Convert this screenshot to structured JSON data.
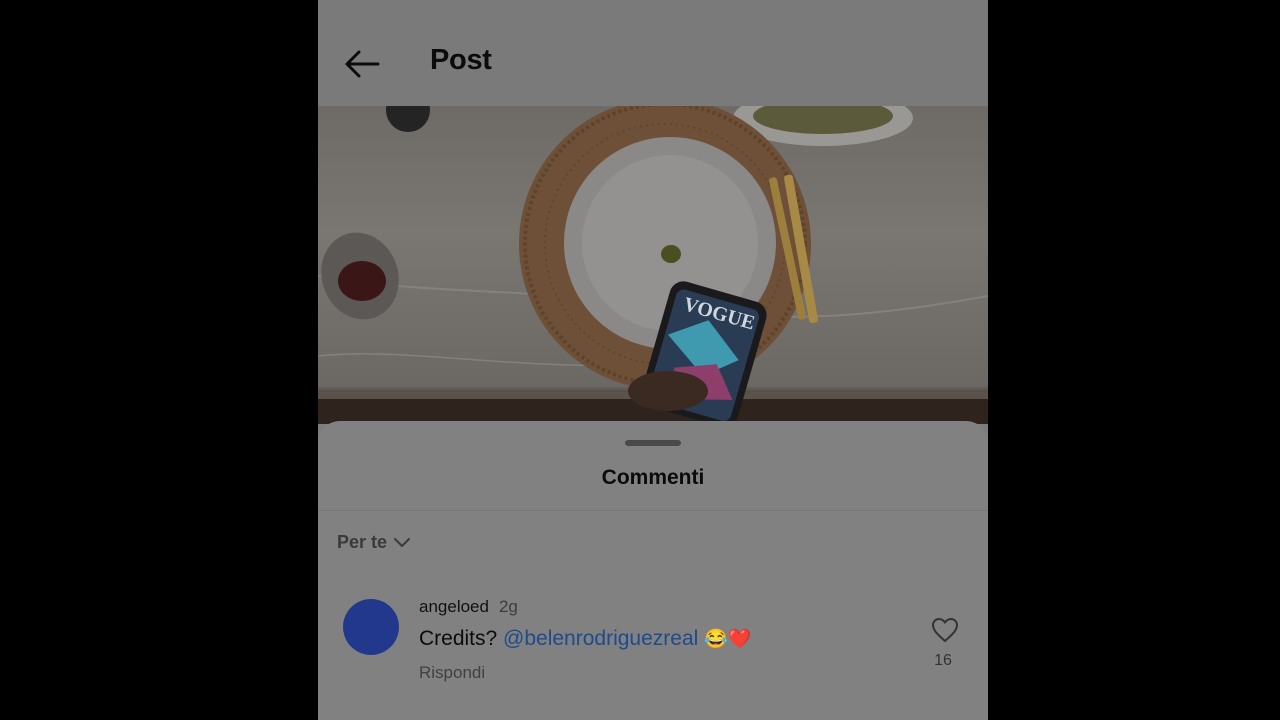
{
  "header": {
    "title": "Post"
  },
  "sheet": {
    "title": "Commenti",
    "sort_label": "Per te"
  },
  "comment": {
    "username": "angeloed",
    "time": "2g",
    "text": "Credits? ",
    "mention": "@belenrodriguezreal",
    "emoji": "😂❤️",
    "reply_label": "Rispondi",
    "likes": "16"
  },
  "colors": {
    "avatar": "#22388c",
    "mention": "#1e4a8e",
    "overlay_bg": "#7d7d7d"
  },
  "icons": {
    "back": "arrow-left-icon",
    "sort": "chevron-down-icon",
    "like": "heart-outline-icon"
  }
}
